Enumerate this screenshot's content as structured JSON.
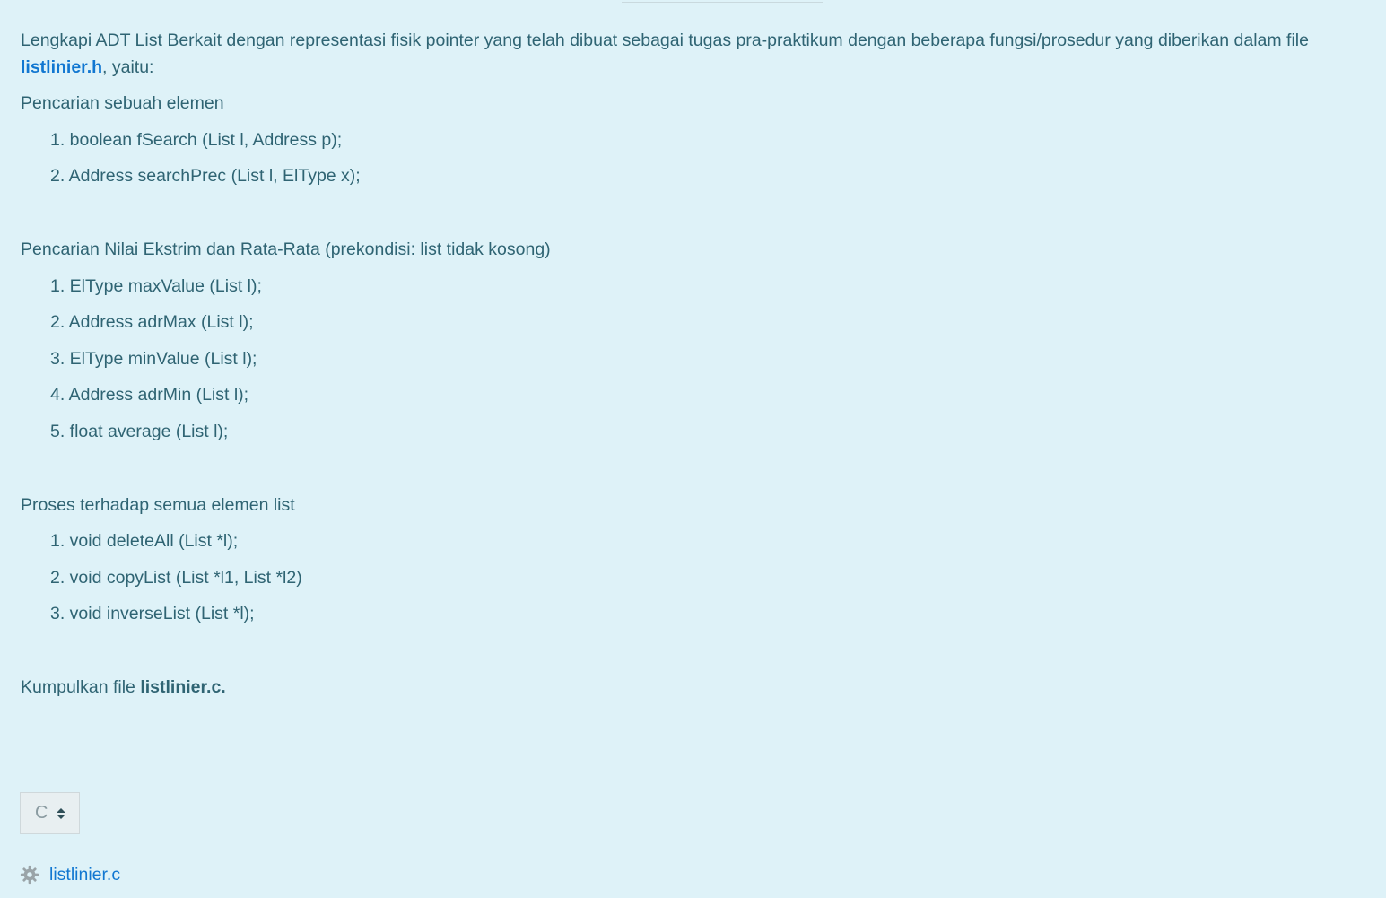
{
  "intro": {
    "text_before": "Lengkapi ADT List Berkait dengan representasi fisik pointer yang telah dibuat sebagai tugas pra-praktikum dengan beberapa fungsi/prosedur yang diberikan dalam file ",
    "link": "listlinier.h",
    "text_after": ", yaitu:"
  },
  "sections": [
    {
      "title": "Pencarian sebuah elemen",
      "items": [
        "1. boolean fSearch (List l, Address p);",
        "2. Address searchPrec (List l, ElType x);"
      ]
    },
    {
      "title": "Pencarian Nilai Ekstrim dan Rata-Rata (prekondisi: list tidak kosong)",
      "items": [
        "1. ElType maxValue (List l);",
        "2. Address adrMax (List l);",
        "3. ElType minValue (List l);",
        "4. Address adrMin (List l);",
        "5. float average (List l);"
      ]
    },
    {
      "title": "Proses terhadap semua elemen list",
      "items": [
        "1. void deleteAll (List *l);",
        "2. void copyList (List *l1, List *l2)",
        "3. void inverseList (List *l);"
      ]
    }
  ],
  "submit": {
    "text_before": "Kumpulkan file ",
    "file": "listlinier.c."
  },
  "language_select": {
    "selected": "C"
  },
  "attachment": {
    "icon": "gear-icon",
    "filename": "listlinier.c"
  },
  "colors": {
    "background": "#def2f8",
    "text": "#2f6473",
    "link": "#1177d1"
  }
}
